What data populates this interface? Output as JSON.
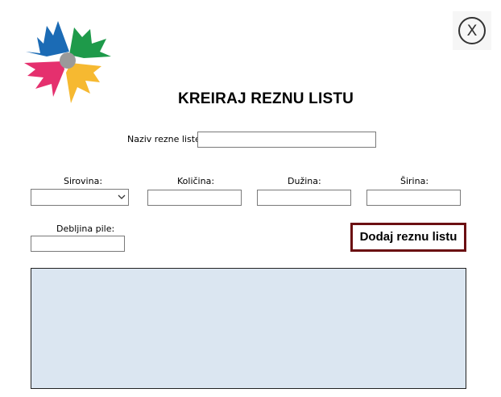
{
  "app": {
    "logo_icon": "company-logo-pinwheel",
    "close_icon": "close-icon",
    "close_glyph": "X"
  },
  "form": {
    "title": "KREIRAJ REZNU LISTU",
    "naziv_label": "Naziv rezne liste:",
    "naziv_value": "",
    "sirovina_label": "Sirovina:",
    "sirovina_value": "",
    "kolicina_label": "Količina:",
    "kolicina_value": "",
    "duzina_label": "Dužina:",
    "duzina_value": "",
    "sirina_label": "Širina:",
    "sirina_value": "",
    "debljina_label": "Debljina pile:",
    "debljina_value": "",
    "add_button_label": "Dodaj reznu listu"
  },
  "colors": {
    "accent_border": "#6b0f12",
    "panel_background": "#dbe6f1",
    "logo_blue": "#1b6bb5",
    "logo_green": "#1e9a4a",
    "logo_pink": "#e5306e",
    "logo_yellow": "#f6b931",
    "logo_center": "#9a9a9a"
  }
}
